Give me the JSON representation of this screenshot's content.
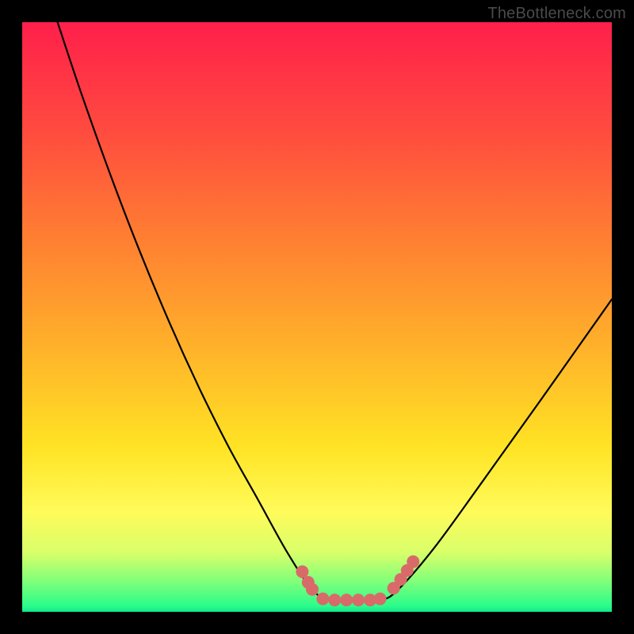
{
  "watermark": "TheBottleneck.com",
  "chart_data": {
    "type": "line",
    "title": "",
    "xlabel": "",
    "ylabel": "",
    "xlim": [
      0,
      1
    ],
    "ylim": [
      0,
      1
    ],
    "series": [
      {
        "name": "bottleneck-curve",
        "x": [
          0.06,
          0.1,
          0.15,
          0.2,
          0.25,
          0.3,
          0.35,
          0.4,
          0.45,
          0.49,
          0.52,
          0.57,
          0.61,
          0.64,
          0.7,
          0.78,
          0.88,
          1.0
        ],
        "y": [
          1.0,
          0.88,
          0.74,
          0.61,
          0.49,
          0.38,
          0.28,
          0.19,
          0.1,
          0.04,
          0.02,
          0.02,
          0.02,
          0.04,
          0.11,
          0.22,
          0.36,
          0.53
        ]
      }
    ],
    "markers": [
      {
        "name": "marker-left-1",
        "x": 0.475,
        "y": 0.068
      },
      {
        "name": "marker-left-2",
        "x": 0.485,
        "y": 0.05
      },
      {
        "name": "marker-left-3",
        "x": 0.492,
        "y": 0.038
      },
      {
        "name": "marker-flat-1",
        "x": 0.51,
        "y": 0.022
      },
      {
        "name": "marker-flat-2",
        "x": 0.53,
        "y": 0.02
      },
      {
        "name": "marker-flat-3",
        "x": 0.55,
        "y": 0.02
      },
      {
        "name": "marker-flat-4",
        "x": 0.57,
        "y": 0.02
      },
      {
        "name": "marker-flat-5",
        "x": 0.59,
        "y": 0.02
      },
      {
        "name": "marker-flat-6",
        "x": 0.607,
        "y": 0.022
      },
      {
        "name": "marker-right-1",
        "x": 0.63,
        "y": 0.04
      },
      {
        "name": "marker-right-2",
        "x": 0.642,
        "y": 0.055
      },
      {
        "name": "marker-right-3",
        "x": 0.653,
        "y": 0.07
      },
      {
        "name": "marker-right-4",
        "x": 0.663,
        "y": 0.085
      }
    ],
    "colors": {
      "curve": "#000000",
      "marker": "#d96a6a"
    }
  }
}
